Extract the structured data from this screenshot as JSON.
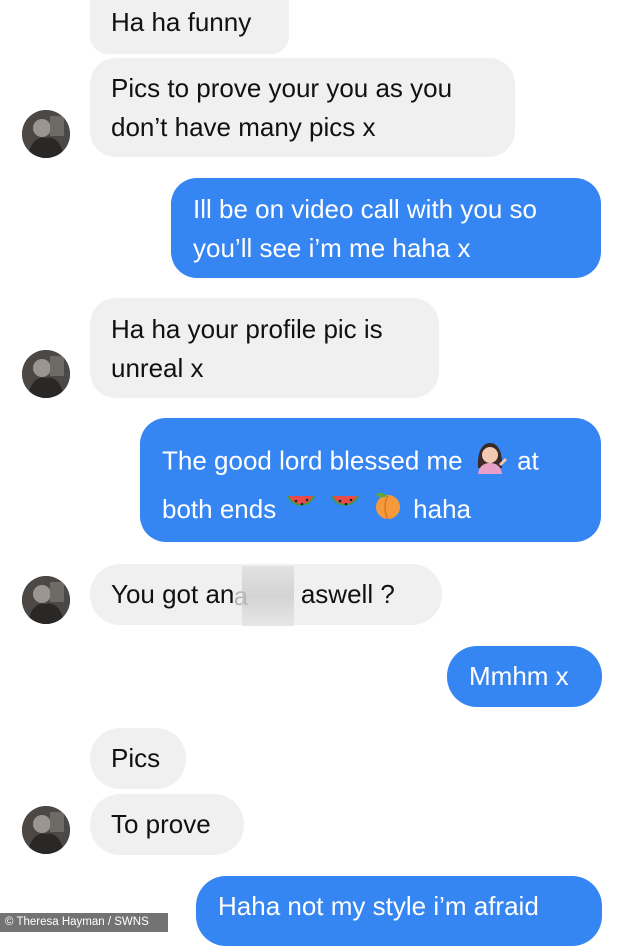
{
  "conversation": {
    "messages": [
      {
        "id": "m1",
        "direction": "incoming",
        "lines": [
          "Ha ha funny"
        ]
      },
      {
        "id": "m2",
        "direction": "incoming",
        "lines": [
          "Pics to prove your you as you",
          "don’t have many pics x"
        ]
      },
      {
        "id": "m3",
        "direction": "outgoing",
        "lines": [
          "Ill be on video call with you so",
          "you’ll see i’m me haha x"
        ]
      },
      {
        "id": "m4",
        "direction": "incoming",
        "lines": [
          "Ha ha your profile pic is",
          "unreal x"
        ]
      },
      {
        "id": "m5",
        "direction": "outgoing",
        "segments": {
          "line1_text": "The good lord blessed me",
          "line1_emoji": "woman-tipping-hand-emoji",
          "line1_after": "at",
          "line2_text": "both ends",
          "line2_emojis": [
            "watermelon-emoji",
            "watermelon-emoji",
            "peach-emoji"
          ],
          "line2_after": "haha"
        }
      },
      {
        "id": "m6",
        "direction": "incoming",
        "before_redaction": "You got an ",
        "redaction_glimpse": "a",
        "after_redaction": "aswell ?",
        "redacted": true
      },
      {
        "id": "m7",
        "direction": "outgoing",
        "lines": [
          "Mmhm x"
        ]
      },
      {
        "id": "m8",
        "direction": "incoming",
        "lines": [
          "Pics"
        ]
      },
      {
        "id": "m9",
        "direction": "incoming",
        "lines": [
          "To prove"
        ]
      },
      {
        "id": "m10",
        "direction": "outgoing",
        "lines": [
          "Haha not my style i’m afraid"
        ]
      }
    ]
  },
  "watermark": {
    "text": "© Theresa Hayman / SWNS"
  },
  "colors": {
    "incoming_bubble": "#f0f0f0",
    "outgoing_bubble": "#3585f2",
    "incoming_text": "#111111",
    "outgoing_text": "#ffffff"
  }
}
